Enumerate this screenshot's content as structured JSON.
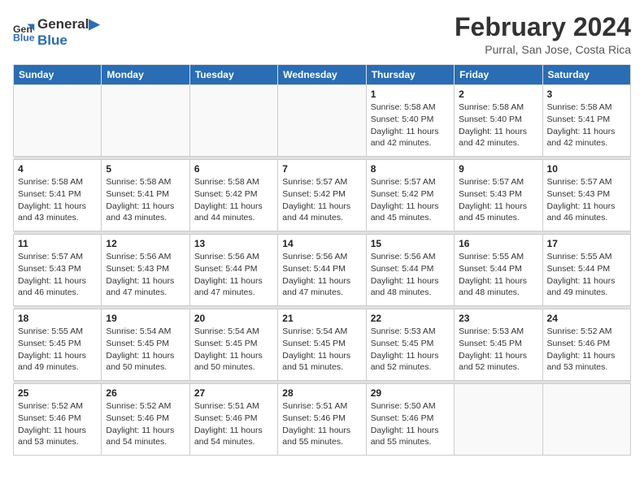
{
  "header": {
    "logo_line1": "General",
    "logo_line2": "Blue",
    "month_title": "February 2024",
    "location": "Purral, San Jose, Costa Rica"
  },
  "days_of_week": [
    "Sunday",
    "Monday",
    "Tuesday",
    "Wednesday",
    "Thursday",
    "Friday",
    "Saturday"
  ],
  "weeks": [
    {
      "days": [
        {
          "num": "",
          "info": ""
        },
        {
          "num": "",
          "info": ""
        },
        {
          "num": "",
          "info": ""
        },
        {
          "num": "",
          "info": ""
        },
        {
          "num": "1",
          "info": "Sunrise: 5:58 AM\nSunset: 5:40 PM\nDaylight: 11 hours\nand 42 minutes."
        },
        {
          "num": "2",
          "info": "Sunrise: 5:58 AM\nSunset: 5:40 PM\nDaylight: 11 hours\nand 42 minutes."
        },
        {
          "num": "3",
          "info": "Sunrise: 5:58 AM\nSunset: 5:41 PM\nDaylight: 11 hours\nand 42 minutes."
        }
      ]
    },
    {
      "days": [
        {
          "num": "4",
          "info": "Sunrise: 5:58 AM\nSunset: 5:41 PM\nDaylight: 11 hours\nand 43 minutes."
        },
        {
          "num": "5",
          "info": "Sunrise: 5:58 AM\nSunset: 5:41 PM\nDaylight: 11 hours\nand 43 minutes."
        },
        {
          "num": "6",
          "info": "Sunrise: 5:58 AM\nSunset: 5:42 PM\nDaylight: 11 hours\nand 44 minutes."
        },
        {
          "num": "7",
          "info": "Sunrise: 5:57 AM\nSunset: 5:42 PM\nDaylight: 11 hours\nand 44 minutes."
        },
        {
          "num": "8",
          "info": "Sunrise: 5:57 AM\nSunset: 5:42 PM\nDaylight: 11 hours\nand 45 minutes."
        },
        {
          "num": "9",
          "info": "Sunrise: 5:57 AM\nSunset: 5:43 PM\nDaylight: 11 hours\nand 45 minutes."
        },
        {
          "num": "10",
          "info": "Sunrise: 5:57 AM\nSunset: 5:43 PM\nDaylight: 11 hours\nand 46 minutes."
        }
      ]
    },
    {
      "days": [
        {
          "num": "11",
          "info": "Sunrise: 5:57 AM\nSunset: 5:43 PM\nDaylight: 11 hours\nand 46 minutes."
        },
        {
          "num": "12",
          "info": "Sunrise: 5:56 AM\nSunset: 5:43 PM\nDaylight: 11 hours\nand 47 minutes."
        },
        {
          "num": "13",
          "info": "Sunrise: 5:56 AM\nSunset: 5:44 PM\nDaylight: 11 hours\nand 47 minutes."
        },
        {
          "num": "14",
          "info": "Sunrise: 5:56 AM\nSunset: 5:44 PM\nDaylight: 11 hours\nand 47 minutes."
        },
        {
          "num": "15",
          "info": "Sunrise: 5:56 AM\nSunset: 5:44 PM\nDaylight: 11 hours\nand 48 minutes."
        },
        {
          "num": "16",
          "info": "Sunrise: 5:55 AM\nSunset: 5:44 PM\nDaylight: 11 hours\nand 48 minutes."
        },
        {
          "num": "17",
          "info": "Sunrise: 5:55 AM\nSunset: 5:44 PM\nDaylight: 11 hours\nand 49 minutes."
        }
      ]
    },
    {
      "days": [
        {
          "num": "18",
          "info": "Sunrise: 5:55 AM\nSunset: 5:45 PM\nDaylight: 11 hours\nand 49 minutes."
        },
        {
          "num": "19",
          "info": "Sunrise: 5:54 AM\nSunset: 5:45 PM\nDaylight: 11 hours\nand 50 minutes."
        },
        {
          "num": "20",
          "info": "Sunrise: 5:54 AM\nSunset: 5:45 PM\nDaylight: 11 hours\nand 50 minutes."
        },
        {
          "num": "21",
          "info": "Sunrise: 5:54 AM\nSunset: 5:45 PM\nDaylight: 11 hours\nand 51 minutes."
        },
        {
          "num": "22",
          "info": "Sunrise: 5:53 AM\nSunset: 5:45 PM\nDaylight: 11 hours\nand 52 minutes."
        },
        {
          "num": "23",
          "info": "Sunrise: 5:53 AM\nSunset: 5:45 PM\nDaylight: 11 hours\nand 52 minutes."
        },
        {
          "num": "24",
          "info": "Sunrise: 5:52 AM\nSunset: 5:46 PM\nDaylight: 11 hours\nand 53 minutes."
        }
      ]
    },
    {
      "days": [
        {
          "num": "25",
          "info": "Sunrise: 5:52 AM\nSunset: 5:46 PM\nDaylight: 11 hours\nand 53 minutes."
        },
        {
          "num": "26",
          "info": "Sunrise: 5:52 AM\nSunset: 5:46 PM\nDaylight: 11 hours\nand 54 minutes."
        },
        {
          "num": "27",
          "info": "Sunrise: 5:51 AM\nSunset: 5:46 PM\nDaylight: 11 hours\nand 54 minutes."
        },
        {
          "num": "28",
          "info": "Sunrise: 5:51 AM\nSunset: 5:46 PM\nDaylight: 11 hours\nand 55 minutes."
        },
        {
          "num": "29",
          "info": "Sunrise: 5:50 AM\nSunset: 5:46 PM\nDaylight: 11 hours\nand 55 minutes."
        },
        {
          "num": "",
          "info": ""
        },
        {
          "num": "",
          "info": ""
        }
      ]
    }
  ]
}
